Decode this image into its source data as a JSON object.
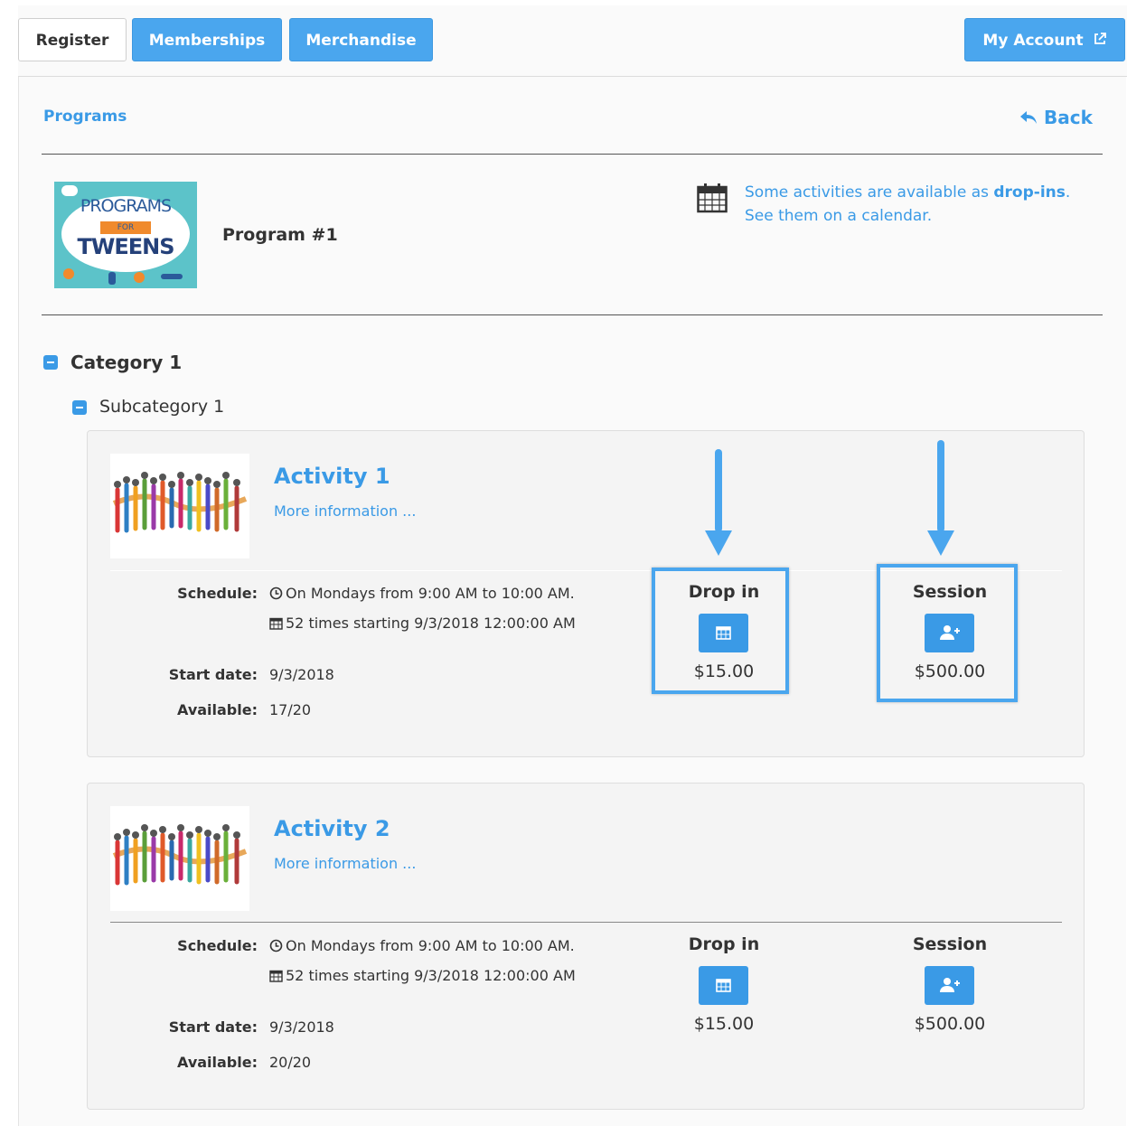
{
  "nav": {
    "tabs": [
      {
        "label": "Register"
      },
      {
        "label": "Memberships"
      },
      {
        "label": "Merchandise"
      }
    ],
    "my_account": "My Account"
  },
  "breadcrumb": {
    "programs": "Programs",
    "back": "Back"
  },
  "program": {
    "logo_text_line1": "PROGRAMS",
    "logo_text_line2": "FOR",
    "logo_text_line3": "TWEENS",
    "title": "Program #1",
    "dropin_notice_prefix": "Some activities are available as ",
    "dropin_notice_bold": "drop-ins",
    "dropin_notice_suffix": ".",
    "calendar_link": "See them on a calendar."
  },
  "category": {
    "name": "Category 1",
    "subcategory": "Subcategory 1"
  },
  "labels": {
    "schedule": "Schedule:",
    "start_date": "Start date:",
    "available": "Available:",
    "drop_in": "Drop in",
    "session": "Session"
  },
  "activities": [
    {
      "title": "Activity 1",
      "more_info": "More information ...",
      "schedule_line1": "On Mondays from 9:00 AM to 10:00 AM.",
      "schedule_line2": "52 times starting 9/3/2018 12:00:00 AM",
      "start_date": "9/3/2018",
      "available": "17/20",
      "dropin_price": "$15.00",
      "session_price": "$500.00"
    },
    {
      "title": "Activity 2",
      "more_info": "More information ...",
      "schedule_line1": "On Mondays from 9:00 AM to 10:00 AM.",
      "schedule_line2": "52 times starting 9/3/2018 12:00:00 AM",
      "start_date": "9/3/2018",
      "available": "20/20",
      "dropin_price": "$15.00",
      "session_price": "$500.00"
    }
  ],
  "colors": {
    "accent": "#3a9ae6",
    "tab_blue": "#4aa6ee",
    "highlight": "#4aa6ee"
  },
  "icons": [
    "external-link-icon",
    "reply-icon",
    "calendar-icon",
    "minus-square-icon",
    "clock-icon",
    "calendar-small-icon",
    "user-plus-icon",
    "arrow-down-icon"
  ]
}
